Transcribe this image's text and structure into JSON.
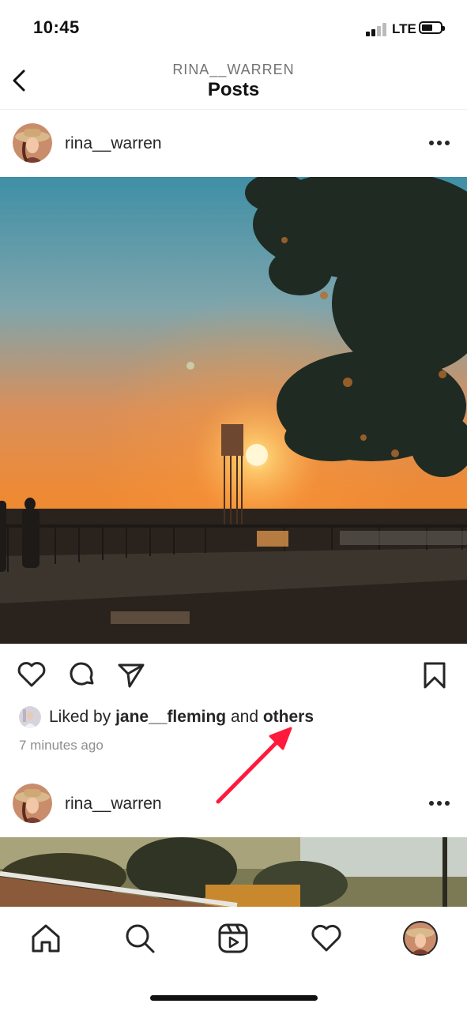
{
  "status_bar": {
    "time": "10:45",
    "network": "LTE"
  },
  "header": {
    "subtitle": "RINA__WARREN",
    "title": "Posts"
  },
  "post1": {
    "username": "rina__warren",
    "liked_prefix": "Liked by ",
    "liked_user": "jane__fleming",
    "liked_middle": " and ",
    "liked_others": "others",
    "time_ago": "7 minutes ago"
  },
  "post2": {
    "username": "rina__warren"
  },
  "icons": {
    "back": "chevron-left-icon",
    "more": "more-horizontal-icon",
    "like": "heart-icon",
    "comment": "comment-icon",
    "share": "send-icon",
    "save": "bookmark-icon",
    "home": "home-icon",
    "search": "search-icon",
    "reels": "reels-icon",
    "activity": "heart-icon",
    "profile": "avatar"
  },
  "colors": {
    "annotation_arrow": "#ff1a3c",
    "secondary_text": "#8e8e8e"
  }
}
